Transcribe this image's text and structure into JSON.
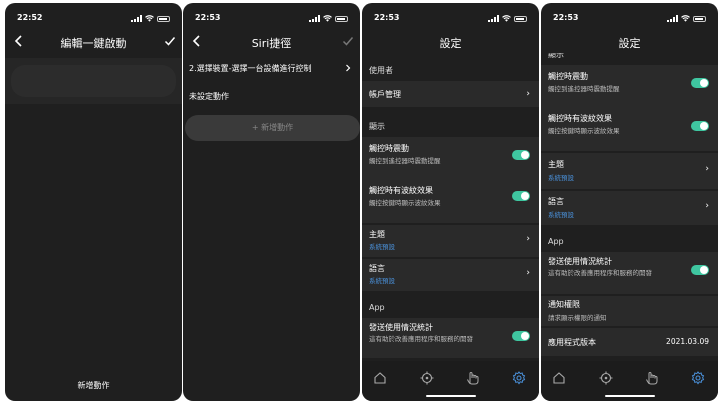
{
  "screens": [
    {
      "time": "22:52",
      "title": "編輯一鍵啟動",
      "bottom_action": "新增動作"
    },
    {
      "time": "22:53",
      "title": "Siri捷徑",
      "device_row": "2.選擇裝置-選擇一台設備進行控制",
      "unset_label": "未設定動作",
      "add_action": "+ 新增動作"
    },
    {
      "time": "22:53",
      "title": "設定",
      "section_user": "使用者",
      "account": "帳戶管理",
      "section_display": "顯示",
      "haptic_label": "觸控時震動",
      "haptic_desc": "觸控到遙控器時震動提醒",
      "ripple_label": "觸控時有波紋效果",
      "ripple_desc": "觸控按鍵時顯示波紋效果",
      "theme_label": "主題",
      "theme_value": "系統預設",
      "lang_label": "語言",
      "lang_value": "系統預設",
      "section_app": "App",
      "stats_label": "發送使用情況統計",
      "stats_desc": "這有助於改善應用程序和服務的開發"
    },
    {
      "time": "22:53",
      "title": "設定",
      "section_display": "顯示",
      "haptic_label": "觸控時震動",
      "haptic_desc": "觸控到遙控器時震動提醒",
      "ripple_label": "觸控時有波紋效果",
      "ripple_desc": "觸控按鍵時顯示波紋效果",
      "theme_label": "主題",
      "theme_value": "系統預設",
      "lang_label": "語言",
      "lang_value": "系統預設",
      "section_app": "App",
      "stats_label": "發送使用情況統計",
      "stats_desc": "這有助於改善應用程序和服務的開發",
      "notify_label": "通知權限",
      "notify_desc": "請求顯示權限的通知",
      "version_label": "應用程式版本",
      "version_value": "2021.03.09"
    }
  ],
  "icons": {
    "tab_home": "home-icon",
    "tab_remote": "crosshair-icon",
    "tab_gesture": "hand-icon",
    "tab_settings": "gear-icon"
  },
  "colors": {
    "toggle_on": "#3fc6a0",
    "link_blue": "#4a90d9"
  }
}
